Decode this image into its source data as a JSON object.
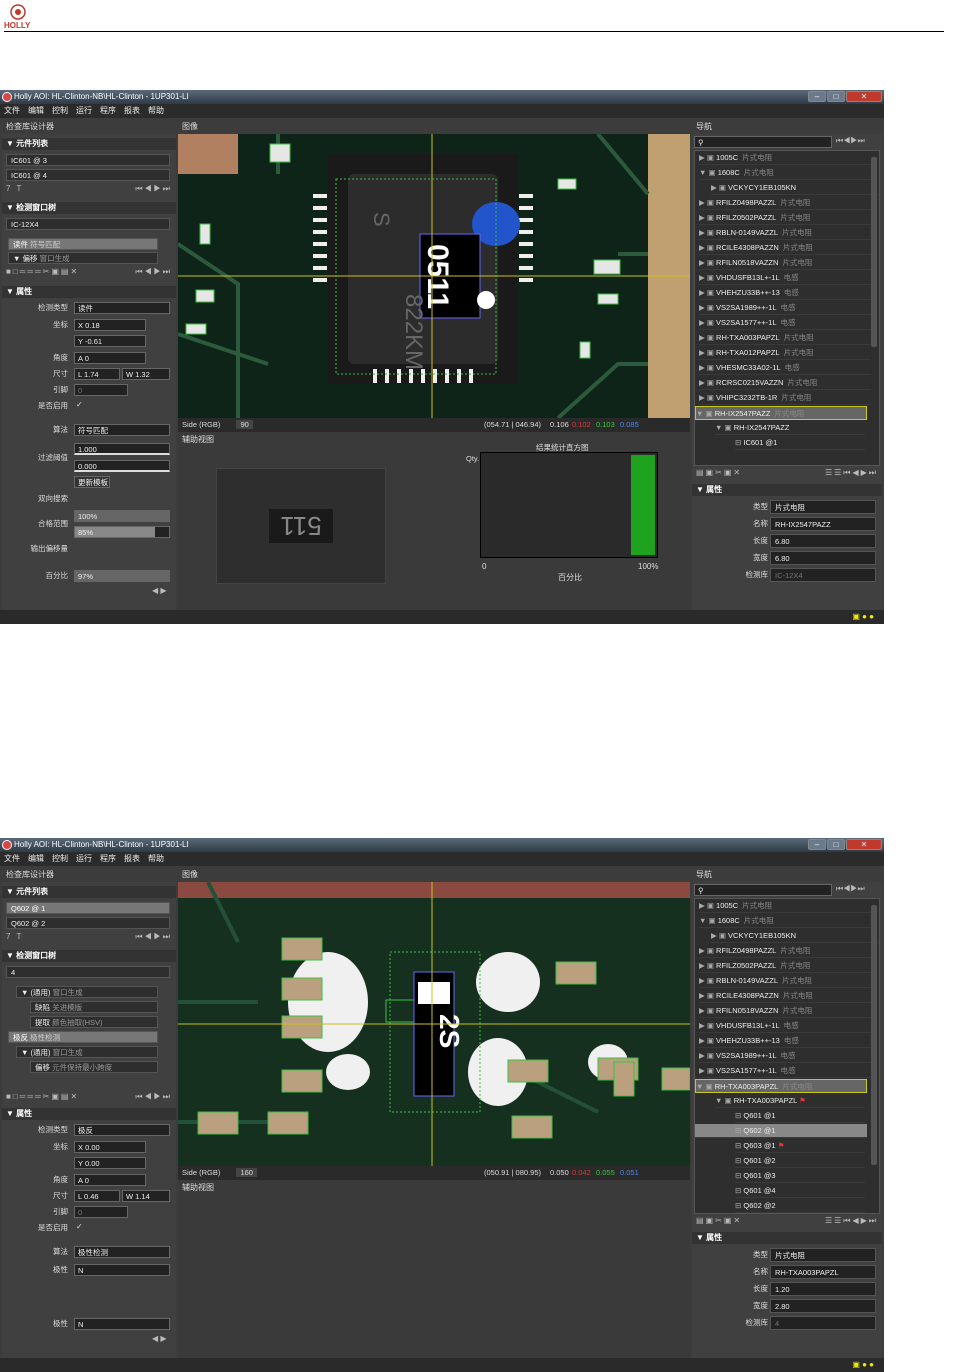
{
  "doc": {
    "logo_text": "HOLLY"
  },
  "screens": [
    {
      "title": "Holly AOI: HL-Clinton-NB\\HL-Clinton - 1UP301-LI",
      "menu": [
        "文件",
        "编辑",
        "控制",
        "运行",
        "程序",
        "报表",
        "帮助"
      ],
      "left_header": "检查库设计器",
      "image_header": "图像",
      "nav_header": "导航",
      "component_list": {
        "title": "元件列表",
        "items": [
          "IC601 @ 3",
          "IC601 @ 4"
        ],
        "label": "7 T"
      },
      "window_list": {
        "title": "检测窗口树",
        "name": "IC-12X4",
        "items": [
          {
            "label": "读件",
            "sub": "符号匹配"
          },
          {
            "label": "偏移",
            "sub": "窗口生成"
          }
        ]
      },
      "props": {
        "title": "属性",
        "type_label": "检测类型",
        "type_value": "读件",
        "coord_label": "坐标",
        "x": "0.18",
        "y": "-0.61",
        "angle_label": "角度",
        "angle": "0",
        "size_label": "尺寸",
        "l": "1.74",
        "w": "1.32",
        "pin_label": "引脚",
        "pin": "0",
        "enable_label": "是否启用",
        "algo_label": "算法",
        "algo_value": "符号匹配",
        "filter_label": "过滤阈值",
        "filter1": "1.000",
        "filter2": "0.000",
        "update_button": "更新模板",
        "bidir_label": "双向搜索",
        "pass_label": "合格范围",
        "pass1": "100%",
        "pass2": "85%",
        "offset_label": "输出偏移量",
        "percent_label": "百分比",
        "percent": "97%"
      },
      "camera": {
        "chip_text": "822KM",
        "label_text": "0511",
        "side_text": "S"
      },
      "status": {
        "mode": "Side (RGB)",
        "value": "90",
        "coords": "(054.71 | 046.94)",
        "v1": "0.106",
        "v2": "0.102",
        "v3": "0.103",
        "v4": "0.085"
      },
      "aux": {
        "title": "辅助视图",
        "thumb_text": "511",
        "hist_title": "结果统计直方图",
        "qty": "Qty.",
        "x0": "0",
        "x1": "100%",
        "xlabel": "百分比"
      },
      "nav": [
        {
          "name": "1005C",
          "type": "片式电阻"
        },
        {
          "name": "1608C",
          "type": "片式电阻"
        },
        {
          "name": "VCKYCY1EB105KN",
          "type": ""
        },
        {
          "name": "RFILZ0498PAZZL",
          "type": "片式电阻"
        },
        {
          "name": "RFILZ0502PAZZL",
          "type": "片式电阻"
        },
        {
          "name": "RBLN-0149VAZZL",
          "type": "片式电阻"
        },
        {
          "name": "RCILE4308PAZZN",
          "type": "片式电阻"
        },
        {
          "name": "RFILN0518VAZZN",
          "type": "片式电阻"
        },
        {
          "name": "VHDUSFB13L+-1L",
          "type": "电感"
        },
        {
          "name": "VHEHZU33B++-13",
          "type": "电感"
        },
        {
          "name": "VS2SA1989++-1L",
          "type": "电感"
        },
        {
          "name": "VS2SA1577++-1L",
          "type": "电感"
        },
        {
          "name": "RH-TXA003PAPZL",
          "type": "片式电阻"
        },
        {
          "name": "RH-TXA012PAPZL",
          "type": "片式电阻"
        },
        {
          "name": "VHESMC33A02-1L",
          "type": "电感"
        },
        {
          "name": "RCRSC0215VAZZN",
          "type": "片式电阻"
        },
        {
          "name": "VHIPC3232TB-1R",
          "type": "片式电阻"
        },
        {
          "name": "RH-IX2547PAZZ",
          "type": "片式电阻"
        },
        {
          "name": "RH-IX2547PAZZ",
          "type": ""
        },
        {
          "name": "IC601 @1",
          "type": ""
        }
      ],
      "nav_props": {
        "title": "属性",
        "type_label": "类型",
        "type": "片式电阻",
        "name_label": "名称",
        "name": "RH-IX2547PAZZ",
        "len_label": "长度",
        "len": "6.80",
        "wid_label": "宽度",
        "wid": "6.80",
        "lib_label": "检测库",
        "lib": "IC-12X4"
      }
    },
    {
      "title": "Holly AOI: HL-Clinton-NB\\HL-Clinton - 1UP301-LI",
      "menu": [
        "文件",
        "编辑",
        "控制",
        "运行",
        "程序",
        "报表",
        "帮助"
      ],
      "left_header": "检查库设计器",
      "image_header": "图像",
      "nav_header": "导航",
      "component_list": {
        "title": "元件列表",
        "items": [
          "Q602 @ 1",
          "Q602 @ 2"
        ],
        "label": "7 T"
      },
      "window_list": {
        "title": "检测窗口树",
        "name": "4",
        "items": [
          {
            "label": "(通用)",
            "sub": "窗口生成"
          },
          {
            "label": "缺陷",
            "sub": "关进模版"
          },
          {
            "label": "提取",
            "sub": "颜色抽取(HSV)"
          },
          {
            "label": "极反",
            "sub": "极性检测"
          },
          {
            "label": "(通用)",
            "sub": "窗口生成"
          },
          {
            "label": "偏移",
            "sub": "元件保持最小跨度"
          }
        ]
      },
      "props": {
        "title": "属性",
        "type_label": "检测类型",
        "type_value": "极反",
        "coord_label": "坐标",
        "x": "0.00",
        "y": "0.00",
        "angle_label": "角度",
        "angle": "0",
        "size_label": "尺寸",
        "l": "0.46",
        "w": "1.14",
        "pin_label": "引脚",
        "pin": "0",
        "enable_label": "是否启用",
        "algo_label": "算法",
        "algo_value": "极性检测",
        "polarity_label": "极性",
        "polarity_value": "N",
        "polarity2_label": "极性",
        "polarity2_value": "N"
      },
      "camera": {
        "label_text": "2S"
      },
      "status": {
        "mode": "Side (RGB)",
        "value": "160",
        "coords": "(050.91 | 080.95)",
        "v1": "0.050",
        "v2": "0.042",
        "v3": "0.055",
        "v4": "0.051"
      },
      "aux": {
        "title": "辅助视图"
      },
      "nav": [
        {
          "name": "1005C",
          "type": "片式电阻"
        },
        {
          "name": "1608C",
          "type": "片式电阻"
        },
        {
          "name": "VCKYCY1EB105KN",
          "type": ""
        },
        {
          "name": "RFILZ0498PAZZL",
          "type": "片式电阻"
        },
        {
          "name": "RFILZ0502PAZZL",
          "type": "片式电阻"
        },
        {
          "name": "RBLN-0149VAZZL",
          "type": "片式电阻"
        },
        {
          "name": "RCILE4308PAZZN",
          "type": "片式电阻"
        },
        {
          "name": "RFILN0518VAZZN",
          "type": "片式电阻"
        },
        {
          "name": "VHDUSFB13L+-1L",
          "type": "电感"
        },
        {
          "name": "VHEHZU33B++-13",
          "type": "电感"
        },
        {
          "name": "VS2SA1989++-1L",
          "type": "电感"
        },
        {
          "name": "VS2SA1577++-1L",
          "type": "电感"
        },
        {
          "name": "RH-TXA003PAPZL",
          "type": "片式电阻"
        },
        {
          "name": "RH-TXA003PAPZL",
          "type": ""
        },
        {
          "name": "Q601 @1",
          "type": ""
        },
        {
          "name": "Q602 @1",
          "type": ""
        },
        {
          "name": "Q603 @1",
          "type": ""
        },
        {
          "name": "Q601 @2",
          "type": ""
        },
        {
          "name": "Q601 @3",
          "type": ""
        },
        {
          "name": "Q601 @4",
          "type": ""
        },
        {
          "name": "Q602 @2",
          "type": ""
        }
      ],
      "nav_props": {
        "title": "属性",
        "type_label": "类型",
        "type": "片式电阻",
        "name_label": "名称",
        "name": "RH-TXA003PAPZL",
        "len_label": "长度",
        "len": "1.20",
        "wid_label": "宽度",
        "wid": "2.80",
        "lib_label": "检测库",
        "lib": "4"
      }
    }
  ]
}
